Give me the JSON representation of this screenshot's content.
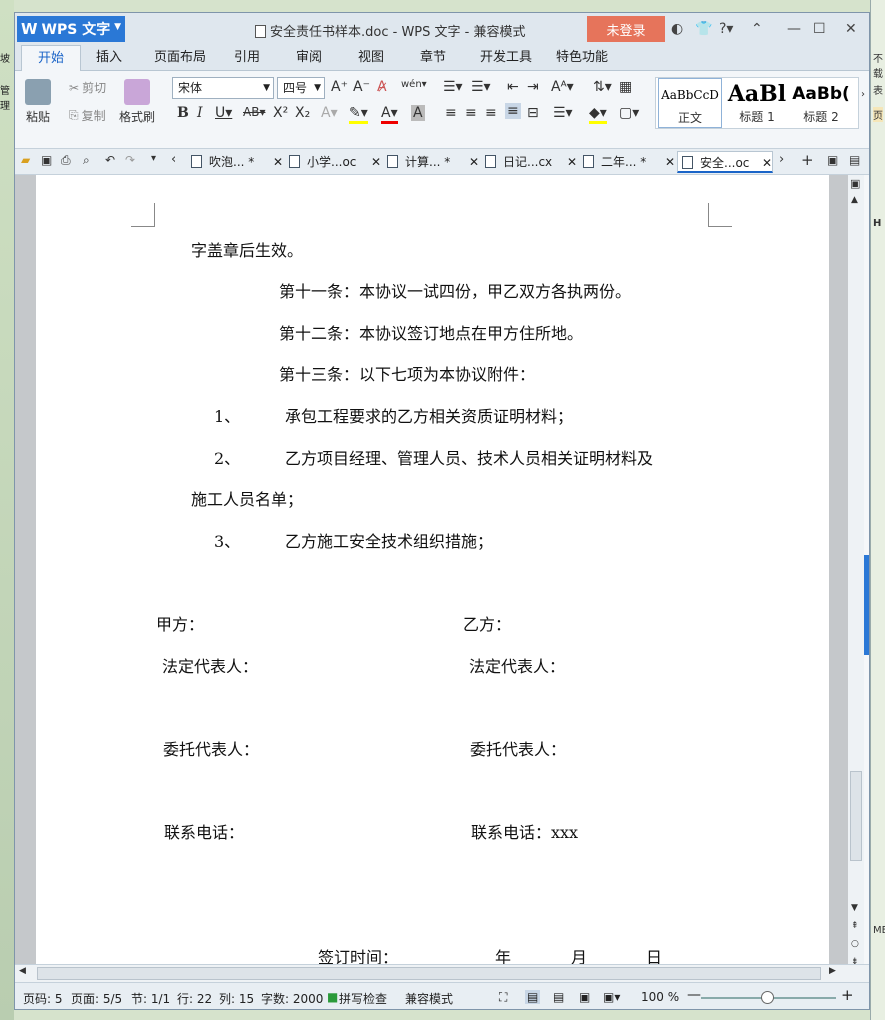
{
  "app": {
    "wps_button": "WPS 文字",
    "title": "安全责任书样本.doc - WPS 文字 - 兼容模式",
    "login": "未登录"
  },
  "ribbon_tabs": [
    "开始",
    "插入",
    "页面布局",
    "引用",
    "审阅",
    "视图",
    "章节",
    "开发工具",
    "特色功能"
  ],
  "ribbon": {
    "paste": "粘贴",
    "cut": "剪切",
    "copy": "复制",
    "format_painter": "格式刷",
    "font_name": "宋体",
    "font_size": "四号",
    "styles": [
      {
        "sample": "AaBbCcD",
        "label": "正文"
      },
      {
        "sample": "AaBl",
        "label": "标题 1"
      },
      {
        "sample": "AaBb(",
        "label": "标题 2"
      }
    ]
  },
  "doc_tabs": [
    {
      "label": "吹泡... *",
      "active": false
    },
    {
      "label": "小学...oc",
      "active": false
    },
    {
      "label": "计算... *",
      "active": false
    },
    {
      "label": "日记...cx",
      "active": false
    },
    {
      "label": "二年... *",
      "active": false
    },
    {
      "label": "安全...oc",
      "active": true
    }
  ],
  "document": {
    "lines": [
      "字盖章后生效。",
      "第十一条：本协议一试四份，甲乙双方各执两份。",
      "第十二条：本协议签订地点在甲方住所地。",
      "第十三条：以下七项为本协议附件：",
      "1、",
      "承包工程要求的乙方相关资质证明材料；",
      "2、",
      "乙方项目经理、管理人员、技术人员相关证明材料及",
      "施工人员名单；",
      "3、",
      "乙方施工安全技术组织措施；",
      "甲方：",
      "乙方：",
      "法定代表人：",
      "法定代表人：",
      "委托代表人：",
      "委托代表人：",
      "联系电话：",
      "联系电话：xxx",
      "签订时间：",
      "年",
      "月",
      "日"
    ]
  },
  "status": {
    "page_code": "页码: 5",
    "pages": "页面: 5/5",
    "section": "节: 1/1",
    "row": "行: 22",
    "col": "列: 15",
    "words": "字数: 2000",
    "spellcheck": "拼写检查",
    "compat": "兼容模式",
    "zoom": "100 %"
  },
  "background_right": {
    "t1": "不载",
    "t2": "表",
    "t3": "页",
    "t4": "H",
    "t5": "ME"
  },
  "background_left": {
    "t1": "坡",
    "t2": "管理"
  }
}
